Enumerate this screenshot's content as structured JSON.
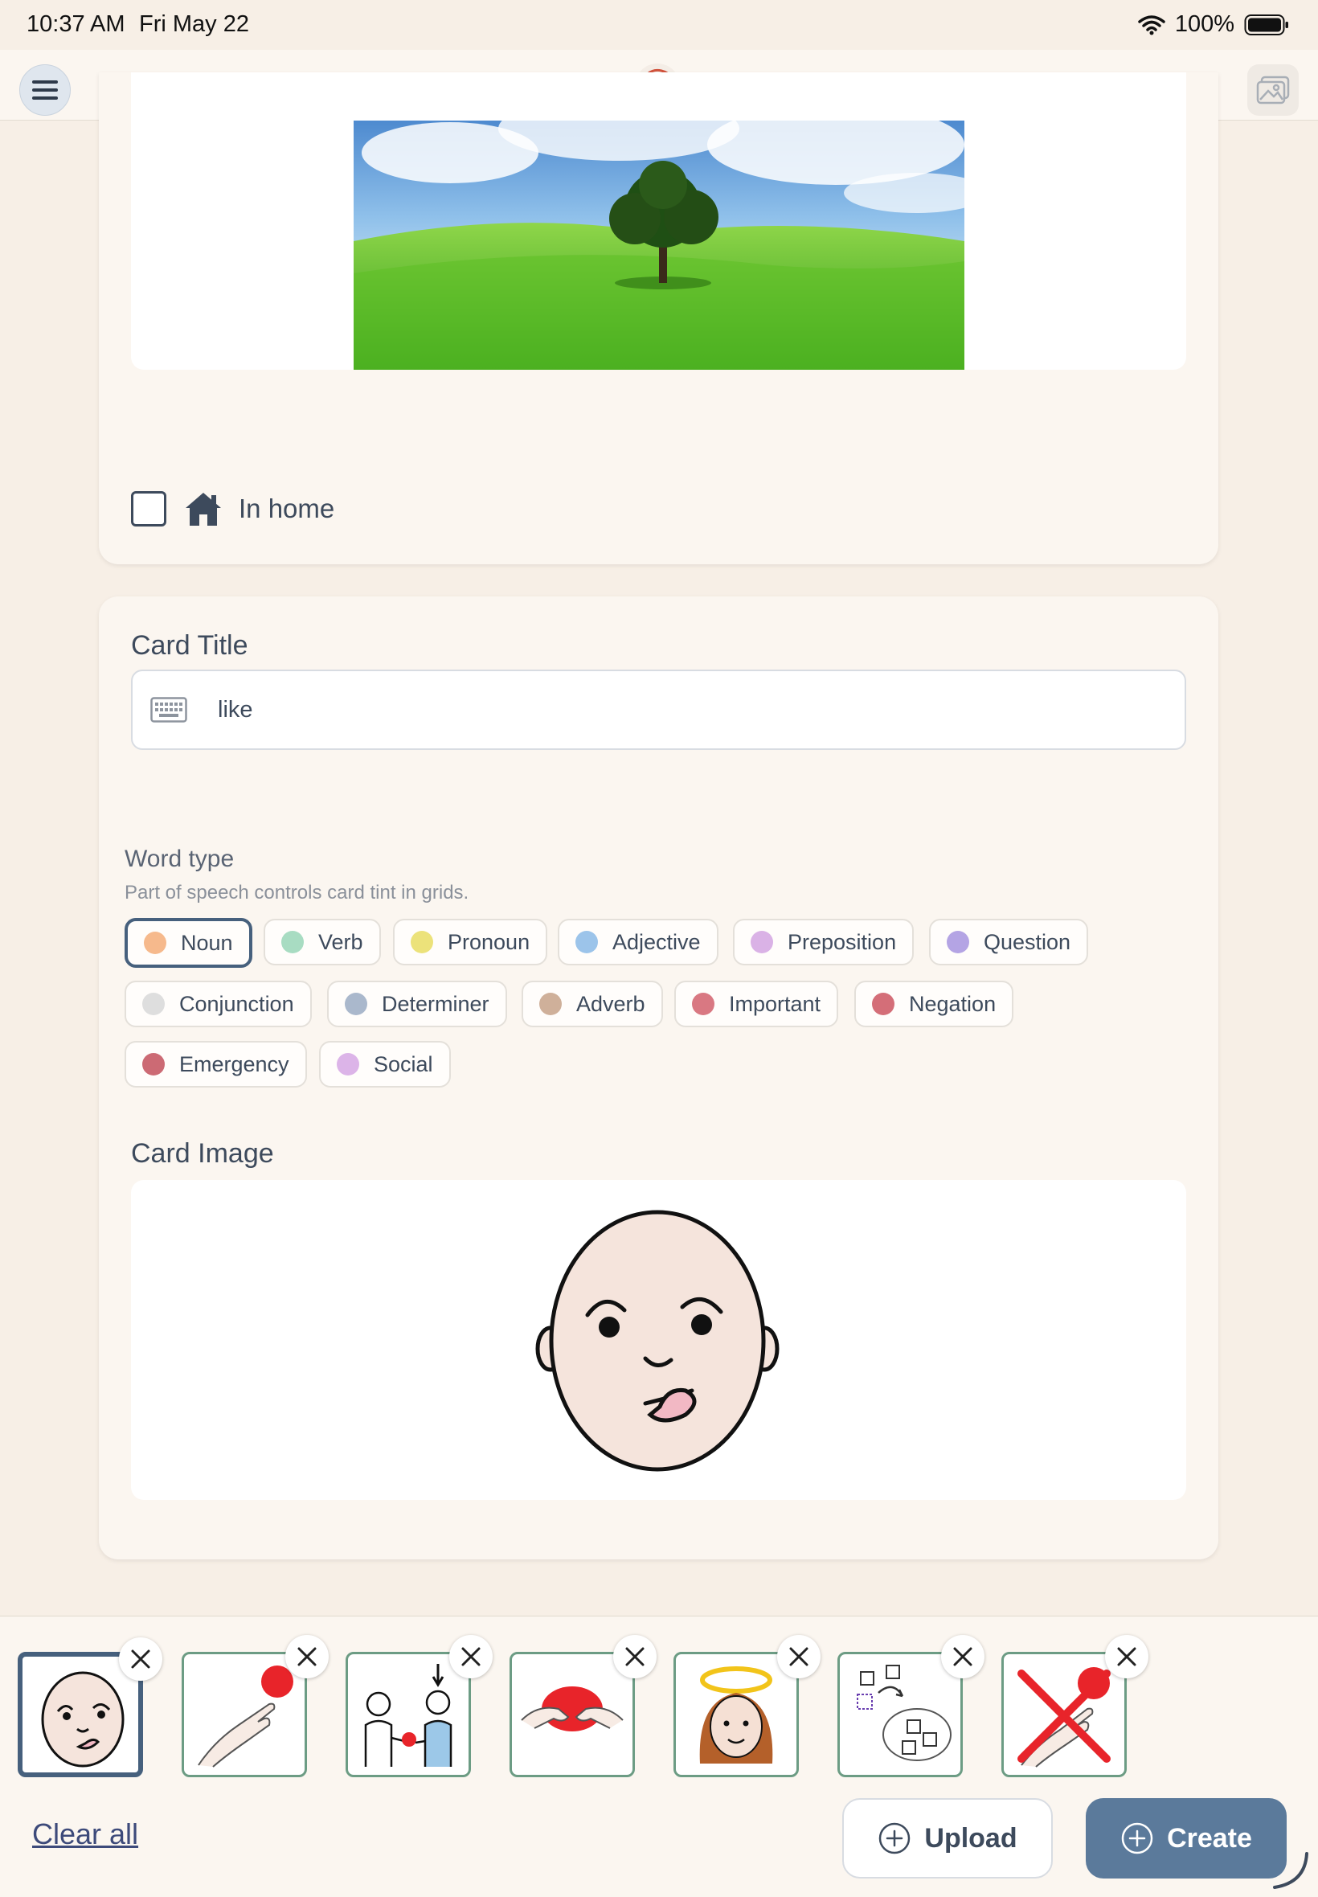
{
  "status_bar": {
    "time": "10:37 AM",
    "date": "Fri May 22",
    "battery": "100%"
  },
  "header": {
    "menu_icon": "hamburger-menu-icon",
    "logo_icon": "app-logo-icon",
    "gallery_icon": "image-gallery-icon"
  },
  "background_card": {
    "photo_description_icon": "landscape-tree-photo",
    "in_home_label": "In home",
    "in_home_checked": false
  },
  "card_title": {
    "label": "Card Title",
    "value": "like",
    "input_icon": "keyboard-icon"
  },
  "word_type": {
    "label": "Word type",
    "help": "Part of speech controls card tint in grids.",
    "selected": "Noun",
    "chips": [
      {
        "label": "Noun",
        "color": "#f6b98c"
      },
      {
        "label": "Verb",
        "color": "#a8dcc2"
      },
      {
        "label": "Pronoun",
        "color": "#ece27a"
      },
      {
        "label": "Adjective",
        "color": "#9cc4ea"
      },
      {
        "label": "Preposition",
        "color": "#dab2e6"
      },
      {
        "label": "Question",
        "color": "#b4a4e4"
      },
      {
        "label": "Conjunction",
        "color": "#dedede"
      },
      {
        "label": "Determiner",
        "color": "#aab8cc"
      },
      {
        "label": "Adverb",
        "color": "#cfb09a"
      },
      {
        "label": "Important",
        "color": "#d97882"
      },
      {
        "label": "Negation",
        "color": "#d46e78"
      },
      {
        "label": "Emergency",
        "color": "#cc6a74"
      },
      {
        "label": "Social",
        "color": "#dcb4e8"
      }
    ]
  },
  "card_image": {
    "label": "Card Image",
    "image_icon": "licking-lips-face-symbol"
  },
  "tray": {
    "thumbnails": [
      {
        "icon": "licking-lips-face-symbol",
        "selected": true
      },
      {
        "icon": "hand-reaching-ball-symbol",
        "selected": false
      },
      {
        "icon": "give-ball-people-symbol",
        "selected": false
      },
      {
        "icon": "hands-holding-red-symbol",
        "selected": false
      },
      {
        "icon": "girl-halo-symbol",
        "selected": false
      },
      {
        "icon": "sort-shapes-symbol",
        "selected": false
      },
      {
        "icon": "no-hand-red-cross-symbol",
        "selected": false
      }
    ],
    "clear_all_label": "Clear all",
    "upload_label": "Upload",
    "create_label": "Create",
    "colors": {
      "create_bg": "#5b7a9b",
      "selected_border": "#46607d",
      "thumb_border": "#6c9c84"
    }
  }
}
